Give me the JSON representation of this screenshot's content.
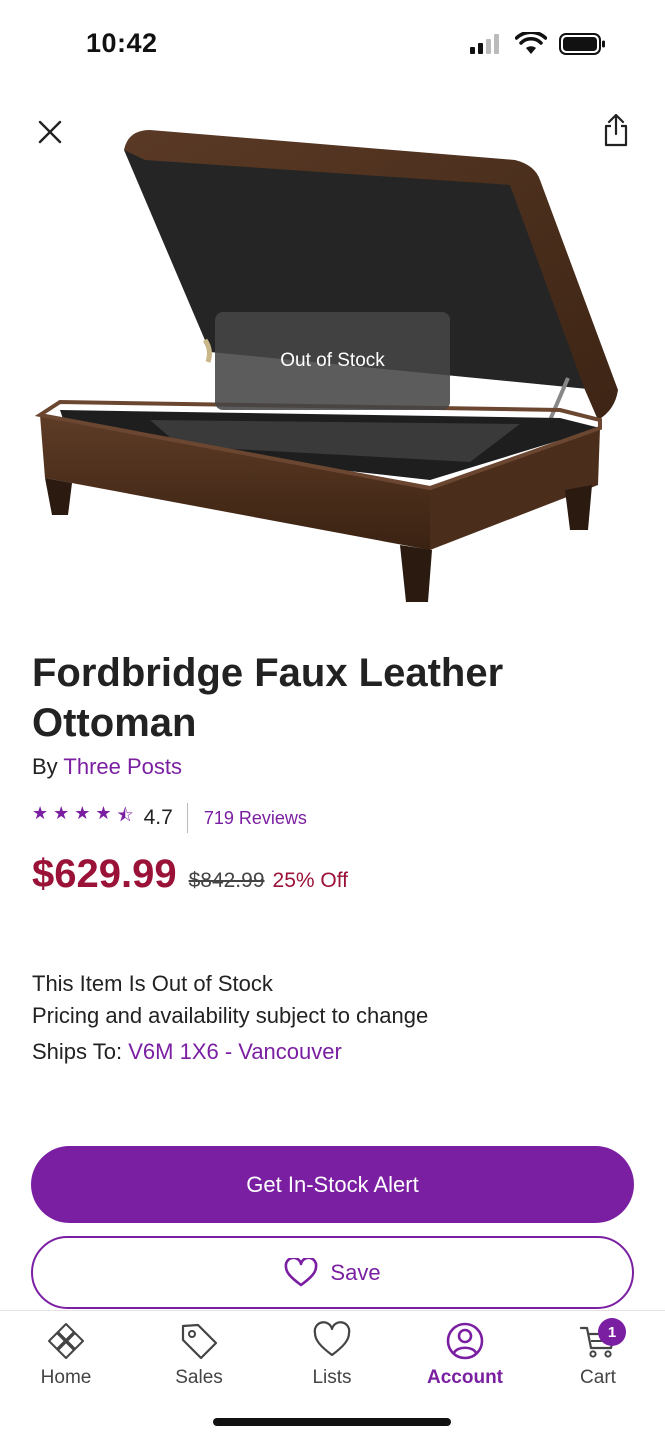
{
  "status_bar": {
    "time": "10:42"
  },
  "hero": {
    "overlay_text": "Out of Stock"
  },
  "product": {
    "title": "Fordbridge Faux Leather Ottoman",
    "by_prefix": "By",
    "brand": "Three Posts",
    "rating": "4.7",
    "rating_fraction": 0.94,
    "reviews_label": "719 Reviews",
    "price": "$629.99",
    "original_price": "$842.99",
    "discount": "25% Off"
  },
  "availability": {
    "status": "This Item Is Out of Stock",
    "note": "Pricing and availability subject to change",
    "ships_to_label": "Ships To:",
    "ships_to_value": "V6M 1X6 - Vancouver"
  },
  "actions": {
    "primary_label": "Get In-Stock Alert",
    "secondary_label": "Save"
  },
  "tabs": [
    {
      "label": "Home",
      "icon": "home-icon"
    },
    {
      "label": "Sales",
      "icon": "tag-icon"
    },
    {
      "label": "Lists",
      "icon": "heart-icon"
    },
    {
      "label": "Account",
      "icon": "account-icon",
      "active": true
    },
    {
      "label": "Cart",
      "icon": "cart-icon",
      "badge": "1"
    }
  ],
  "colors": {
    "accent": "#7b1fa2",
    "price": "#9b1238"
  }
}
